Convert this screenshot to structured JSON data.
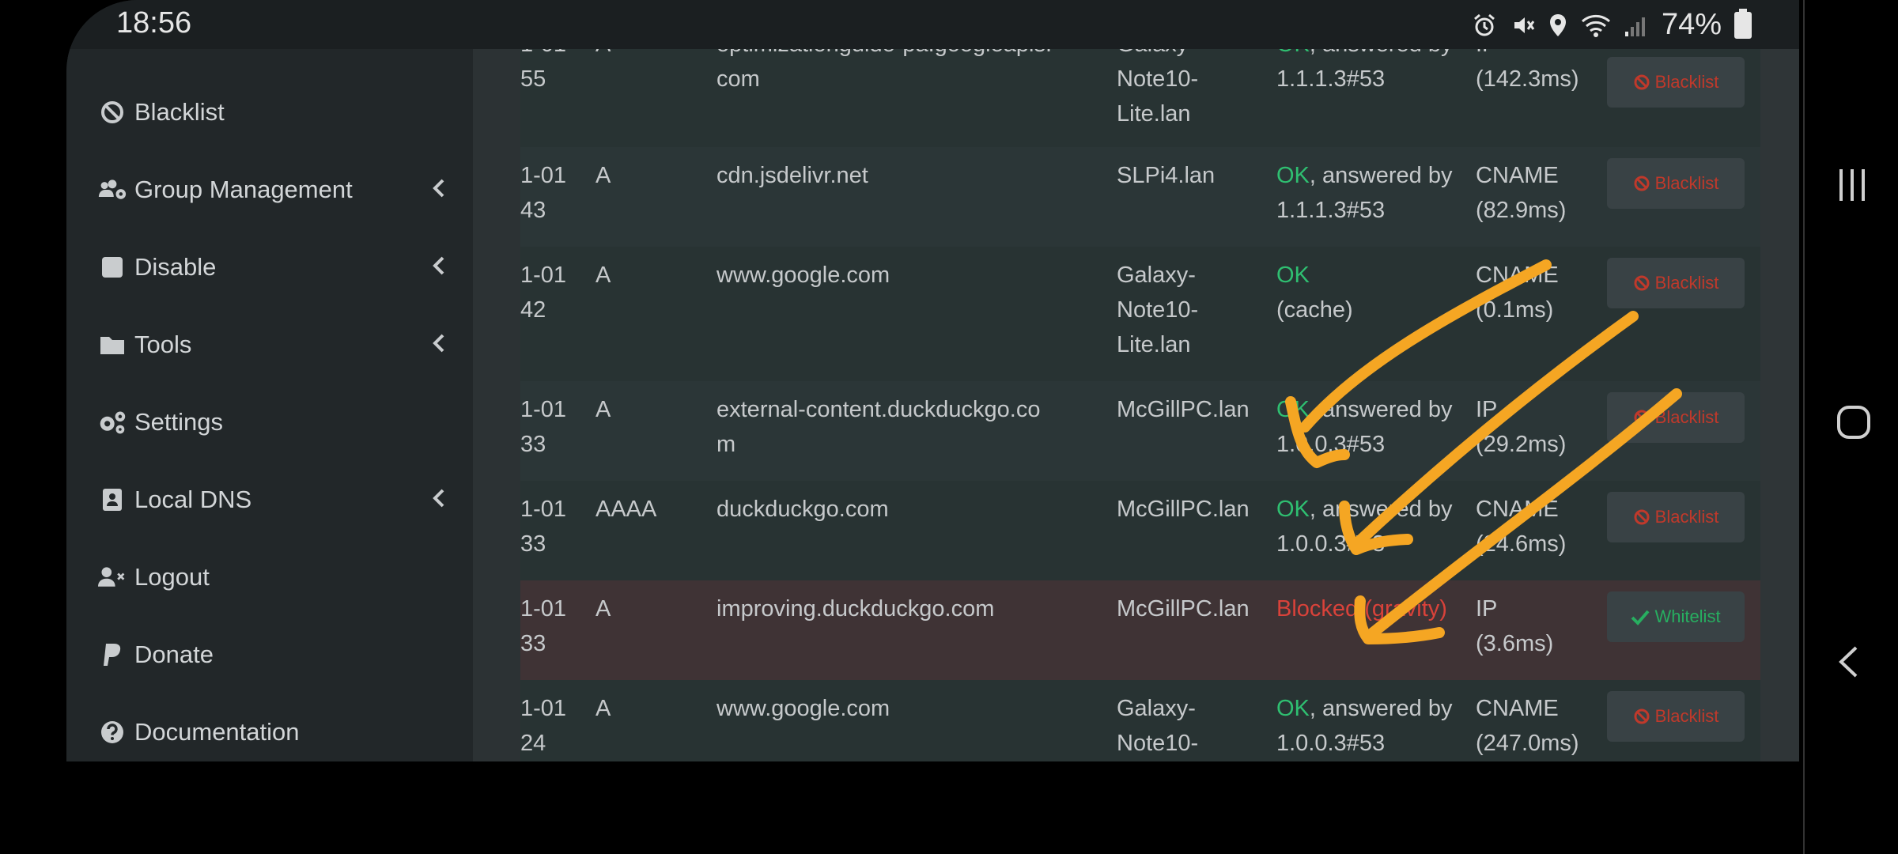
{
  "status_bar": {
    "time": "18:56",
    "battery": "74%",
    "icons": [
      "alarm-icon",
      "mute-icon",
      "location-icon",
      "wifi-icon",
      "signal-icon",
      "battery-icon"
    ]
  },
  "sidebar": {
    "items": [
      {
        "label": "Blacklist",
        "icon": "ban-icon",
        "caret": false
      },
      {
        "label": "Group Management",
        "icon": "users-cog-icon",
        "caret": true
      },
      {
        "label": "Disable",
        "icon": "stop-icon",
        "caret": true
      },
      {
        "label": "Tools",
        "icon": "folder-icon",
        "caret": true
      },
      {
        "label": "Settings",
        "icon": "cogs-icon",
        "caret": false
      },
      {
        "label": "Local DNS",
        "icon": "address-book-icon",
        "caret": true
      },
      {
        "label": "Logout",
        "icon": "user-times-icon",
        "caret": false
      },
      {
        "label": "Donate",
        "icon": "paypal-icon",
        "caret": false
      },
      {
        "label": "Documentation",
        "icon": "question-circle-icon",
        "caret": false
      }
    ]
  },
  "table": {
    "rows": [
      {
        "time": [
          "1-01",
          "55"
        ],
        "type": "A",
        "domain": [
          "optimizationguide-pa.googleapis.",
          "com"
        ],
        "client": [
          "Galaxy-",
          "Note10-",
          "Lite.lan"
        ],
        "status_ok": "OK",
        "status_rest": ", answered by",
        "status_line2": "1.1.1.3#53",
        "reply": [
          "IP",
          "(142.3ms)"
        ],
        "action": "Blacklist"
      },
      {
        "time": [
          "1-01",
          "43"
        ],
        "type": "A",
        "domain": [
          "cdn.jsdelivr.net"
        ],
        "client": [
          "SLPi4.lan"
        ],
        "status_ok": "OK",
        "status_rest": ", answered by",
        "status_line2": "1.1.1.3#53",
        "reply": [
          "CNAME",
          "(82.9ms)"
        ],
        "action": "Blacklist"
      },
      {
        "time": [
          "1-01",
          "42"
        ],
        "type": "A",
        "domain": [
          "www.google.com"
        ],
        "client": [
          "Galaxy-",
          "Note10-",
          "Lite.lan"
        ],
        "status_ok": "OK",
        "status_rest": "",
        "status_line2": "(cache)",
        "reply": [
          "CNAME",
          "(0.1ms)"
        ],
        "action": "Blacklist"
      },
      {
        "time": [
          "1-01",
          "33"
        ],
        "type": "A",
        "domain": [
          "external-content.duckduckgo.co",
          "m"
        ],
        "client": [
          "McGillPC.lan"
        ],
        "status_ok": "OK",
        "status_rest": ", answered by",
        "status_line2": "1.0.0.3#53",
        "reply": [
          "IP",
          "(29.2ms)"
        ],
        "action": "Blacklist"
      },
      {
        "time": [
          "1-01",
          "33"
        ],
        "type": "AAAA",
        "domain": [
          "duckduckgo.com"
        ],
        "client": [
          "McGillPC.lan"
        ],
        "status_ok": "OK",
        "status_rest": ", answered by",
        "status_line2": "1.0.0.3#53",
        "reply": [
          "CNAME",
          "(24.6ms)"
        ],
        "action": "Blacklist"
      },
      {
        "time": [
          "1-01",
          "33"
        ],
        "type": "A",
        "domain": [
          "improving.duckduckgo.com"
        ],
        "client": [
          "McGillPC.lan"
        ],
        "status_blocked": "Blocked (gravity)",
        "reply": [
          "IP",
          "(3.6ms)"
        ],
        "action": "Whitelist"
      },
      {
        "time": [
          "1-01",
          "24"
        ],
        "type": "A",
        "domain": [
          "www.google.com"
        ],
        "client": [
          "Galaxy-",
          "Note10-"
        ],
        "status_ok": "OK",
        "status_rest": ", answered by",
        "status_line2": "1.0.0.3#53",
        "reply": [
          "CNAME",
          "(247.0ms)"
        ],
        "action": "Blacklist"
      }
    ]
  },
  "colors": {
    "ok": "#2fbf71",
    "blocked": "#d9423a",
    "arrow": "#f5a623"
  },
  "navigation": {
    "icons": [
      "recent-apps-icon",
      "home-icon",
      "back-icon"
    ]
  }
}
